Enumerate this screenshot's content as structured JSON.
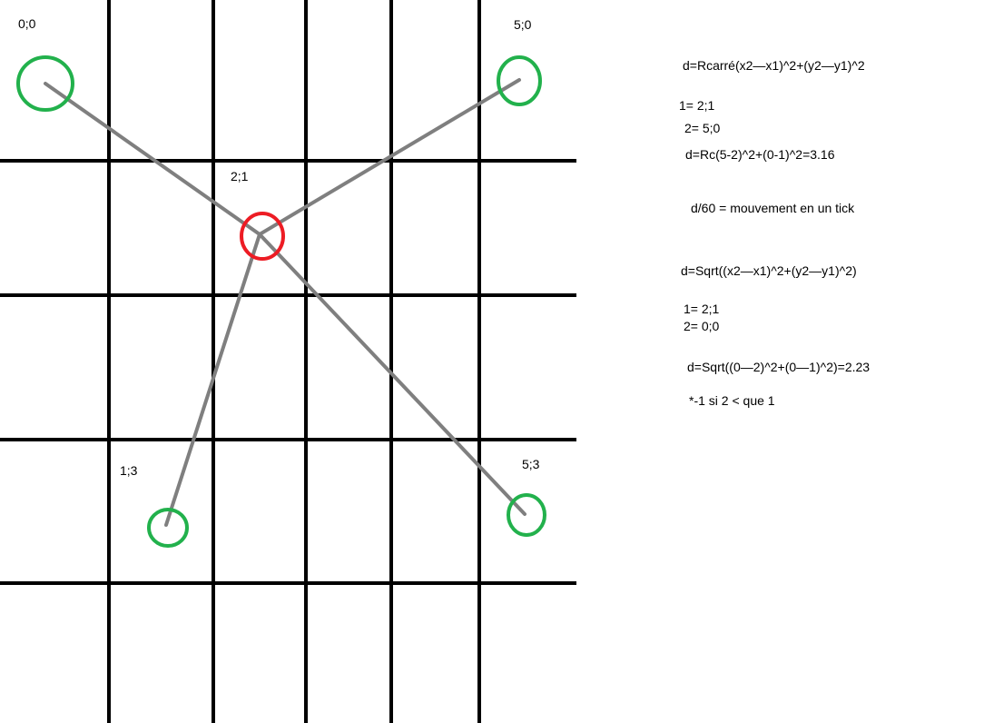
{
  "diagram": {
    "colors": {
      "grid": "#000000",
      "connector": "#7f7f7f",
      "target": "#ed1c24",
      "source": "#22b14c"
    },
    "labels": {
      "p00": "0;0",
      "p50": "5;0",
      "p21": "2;1",
      "p13": "1;3",
      "p53": "5;3"
    }
  },
  "notes": {
    "formula_fr": "d=Rcarré(x2—x1)^2+(y2—y1)^2",
    "ex1_p1": "1= 2;1",
    "ex1_p2": "2= 5;0",
    "ex1_result": "d=Rc(5-2)^2+(0-1)^2=3.16",
    "tick_rule": "d/60 = mouvement en un tick",
    "formula_sqrt": "d=Sqrt((x2—x1)^2+(y2—y1)^2)",
    "ex2_p1": "1= 2;1",
    "ex2_p2": "2= 0;0",
    "ex2_result": "d=Sqrt((0—2)^2+(0—1)^2)=2.23",
    "sign_rule": "*-1 si 2 < que 1"
  }
}
